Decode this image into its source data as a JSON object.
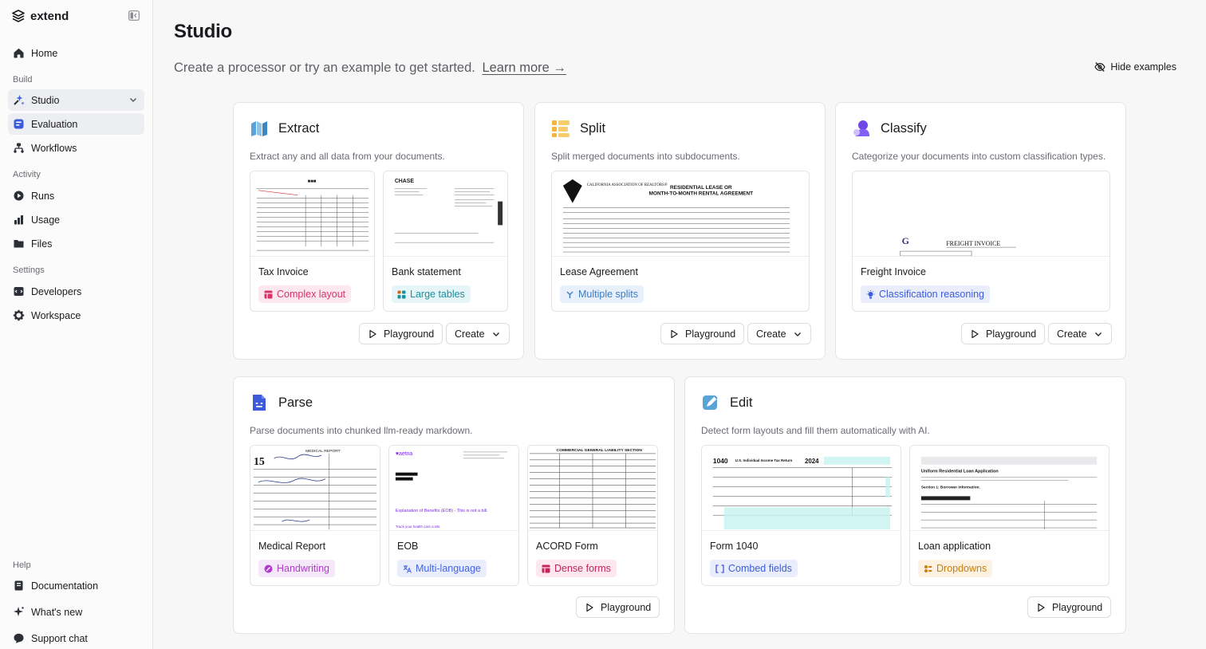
{
  "app": {
    "name": "extend"
  },
  "sidebar": {
    "home": "Home",
    "sections": {
      "build": "Build",
      "activity": "Activity",
      "settings": "Settings",
      "help": "Help"
    },
    "build_items": [
      "Studio",
      "Evaluation",
      "Workflows"
    ],
    "activity_items": [
      "Runs",
      "Usage",
      "Files"
    ],
    "settings_items": [
      "Developers",
      "Workspace"
    ],
    "help_items": [
      "Documentation",
      "What's new",
      "Support chat"
    ],
    "active": "Studio"
  },
  "page": {
    "title": "Studio",
    "subtitle": "Create a processor or try an example to get started.",
    "learn_more": "Learn more →",
    "hide_examples": "Hide examples"
  },
  "buttons": {
    "playground": "Playground",
    "create": "Create"
  },
  "cards": {
    "extract": {
      "title": "Extract",
      "desc": "Extract any and all data from your documents.",
      "samples": [
        {
          "name": "Tax Invoice",
          "tag": "Complex layout"
        },
        {
          "name": "Bank statement",
          "tag": "Large tables"
        }
      ]
    },
    "split": {
      "title": "Split",
      "desc": "Split merged documents into subdocuments.",
      "samples": [
        {
          "name": "Lease Agreement",
          "tag": "Multiple splits"
        }
      ]
    },
    "classify": {
      "title": "Classify",
      "desc": "Categorize your documents into custom classification types.",
      "samples": [
        {
          "name": "Freight Invoice",
          "tag": "Classification reasoning"
        }
      ]
    },
    "parse": {
      "title": "Parse",
      "desc": "Parse documents into chunked llm-ready markdown.",
      "samples": [
        {
          "name": "Medical Report",
          "tag": "Handwriting"
        },
        {
          "name": "EOB",
          "tag": "Multi-language"
        },
        {
          "name": "ACORD Form",
          "tag": "Dense forms"
        }
      ]
    },
    "edit": {
      "title": "Edit",
      "desc": "Detect form layouts and fill them automatically with AI.",
      "samples": [
        {
          "name": "Form 1040",
          "tag": "Combed fields"
        },
        {
          "name": "Loan application",
          "tag": "Dropdowns"
        }
      ]
    }
  },
  "thumb_text": {
    "bank": "CHASE",
    "lease_heading_1": "RESIDENTIAL LEASE OR",
    "lease_heading_2": "MONTH-TO-MONTH RENTAL AGREEMENT",
    "lease_org": "CALIFORNIA ASSOCIATION OF REALTORS®",
    "freight": "FREIGHT INVOICE",
    "medical_num": "15",
    "medical_head": "MEDICAL REPORT",
    "eob_brand": "♥aetna",
    "eob_line": "Explanation of Benefits (EOB) - This is not a bill.",
    "eob_line2": "Track your health care costs",
    "acord_head": "COMMERCIAL GENERAL LIABILITY SECTION",
    "f1040_num": "1040",
    "f1040_title": "U.S. Individual Income Tax Return",
    "f1040_year": "2024",
    "loan_title": "Uniform Residential Loan Application",
    "loan_section": "Section 1: Borrower Information."
  },
  "colors": {
    "accent": "#3b5bdb",
    "complex": "#d6336c",
    "tables": "#1c8f9e",
    "splits": "#3b7bbf",
    "reasoning": "#3b5bdb",
    "handwriting": "#ae3ec9",
    "multilang": "#4263eb",
    "dense": "#c2255c",
    "combed": "#3b5bdb",
    "dropdowns": "#c77d12"
  }
}
